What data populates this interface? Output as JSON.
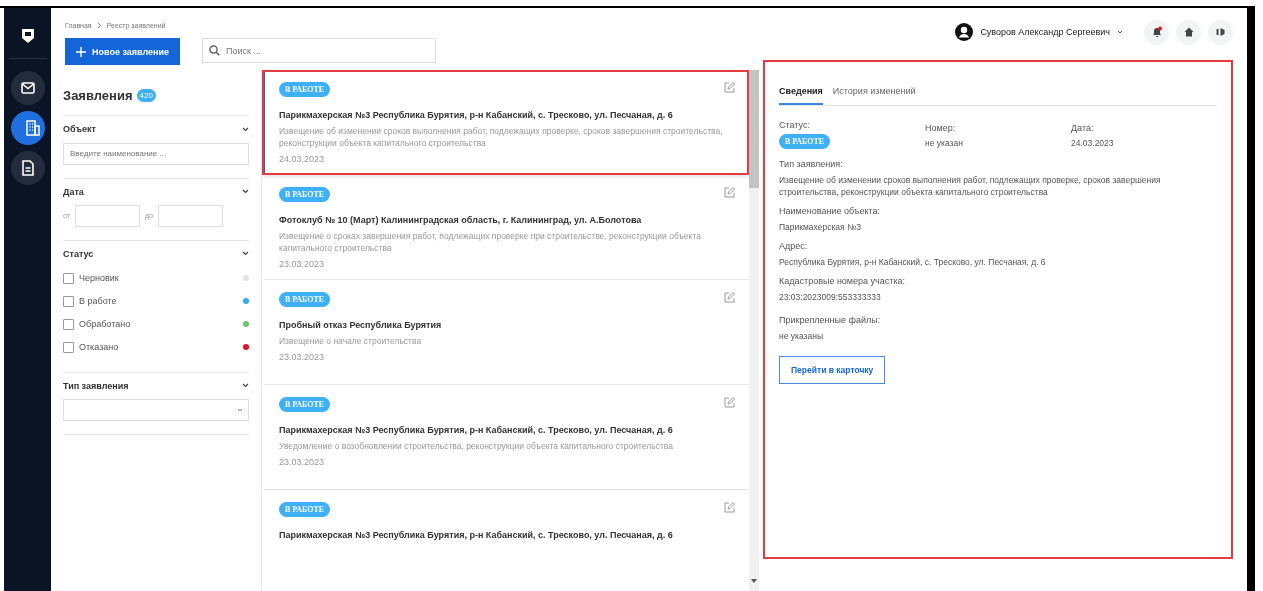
{
  "nav": [
    {
      "kind": "logo",
      "selected": false
    },
    {
      "kind": "mail",
      "selected": false
    },
    {
      "kind": "building",
      "selected": true
    },
    {
      "kind": "document",
      "selected": false
    }
  ],
  "breadcrumb": [
    "Главная",
    "Реестр заявлений"
  ],
  "new_button": "Новое заявление",
  "search": {
    "placeholder": "Поиск ..."
  },
  "user": {
    "name": "Суворов Александр Сергеевич",
    "notification": true
  },
  "filters": {
    "title": "Заявления",
    "count": "420",
    "object": {
      "label": "Объект",
      "placeholder": "Введите наименование ..."
    },
    "date": {
      "label": "Дата",
      "from": "от",
      "to": "до"
    },
    "status": {
      "label": "Статус",
      "options": [
        {
          "label": "Черновик",
          "checked": false,
          "color": "#e2e2e8"
        },
        {
          "label": "В работе",
          "checked": false,
          "color": "#33aaf5"
        },
        {
          "label": "Обработано",
          "checked": false,
          "color": "#6cc46c"
        },
        {
          "label": "Отказано",
          "checked": false,
          "color": "#e8102a"
        }
      ]
    },
    "type": {
      "label": "Тип заявления"
    }
  },
  "applications": [
    {
      "status": "В РАБОТЕ",
      "title": "Парикмахерская №3 Республика Бурятия, р-н Кабанский, с. Тресково, ул. Песчаная, д. 6",
      "type": "Извещение об изменении сроков выполнения работ, подлежащих проверке, сроков завершения строительства, реконструкции объекта капитального строительства",
      "date": "24.03.2023",
      "selected": true,
      "highlighted": true
    },
    {
      "status": "В РАБОТЕ",
      "title": "Фотоклуб № 10 (Март) Калининградская область, г. Калининград, ул. А.Болотова",
      "type": "Извещение о сроках завершения работ, подлежащих проверке при строительстве, реконструкции объекта капитального строительства",
      "date": "23.03.2023",
      "selected": false,
      "highlighted": false
    },
    {
      "status": "В РАБОТЕ",
      "title": "Пробный отказ Республика Бурятия",
      "type": "Извещение о начале строительства",
      "date": "23.03.2023",
      "selected": false,
      "highlighted": false
    },
    {
      "status": "В РАБОТЕ",
      "title": "Парикмахерская №3 Республика Бурятия, р-н Кабанский, с. Тресково, ул. Песчаная, д. 6",
      "type": "Уведомление о возобновлении строительства, реконструкции объекта капитального строительства",
      "date": "23.03.2023",
      "selected": false,
      "highlighted": false
    },
    {
      "status": "В РАБОТЕ",
      "title": "Парикмахерская №3 Республика Бурятия, р-н Кабанский, с. Тресково, ул. Песчаная, д. 6",
      "selected": false,
      "highlighted": false
    }
  ],
  "details": {
    "highlighted": true,
    "tabs": [
      {
        "label": "Сведения",
        "selected": true
      },
      {
        "label": "История изменений",
        "selected": false
      }
    ],
    "status_label": "Статус:",
    "status": "В РАБОТЕ",
    "number_label": "Номер:",
    "number": "не указан",
    "date_label": "Дата:",
    "date": "24.03.2023",
    "fields": [
      {
        "label": "Тип заявления:",
        "value": "Извещение об изменении сроков выполнения работ, подлежащих проверке, сроков завершения строительства, реконструкции объекта капитального строительства"
      },
      {
        "label": "Наименование объекта:",
        "value": "Парикмахерская №3"
      },
      {
        "label": "Адрес:",
        "value": "Республика Бурятия, р-н Кабанский, с. Тресково, ул. Песчаная, д. 6"
      },
      {
        "label": "Кадастровые номера участка:",
        "value": "23:03:2023009:553333333"
      },
      {
        "label": "Прикрепленные файлы:",
        "value": "не указаны"
      }
    ],
    "button": "Перейти в карточку"
  }
}
